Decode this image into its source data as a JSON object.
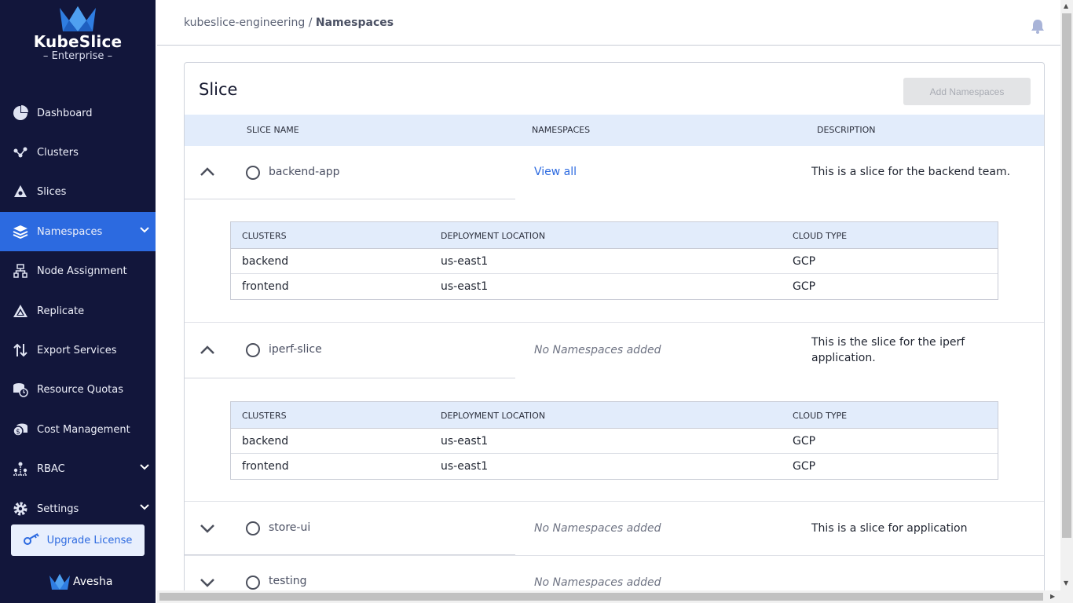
{
  "brand": {
    "title": "KubeSlice",
    "subtitle": "Enterprise",
    "footer": "Avesha"
  },
  "colors": {
    "sidebar_bg": "#12163b",
    "accent": "#2c6ae0",
    "table_header_bg": "#e2ecfb"
  },
  "sidebar": {
    "items": [
      {
        "label": "Dashboard",
        "icon": "pie-chart-icon"
      },
      {
        "label": "Clusters",
        "icon": "cluster-nodes-icon"
      },
      {
        "label": "Slices",
        "icon": "slice-icon"
      },
      {
        "label": "Namespaces",
        "icon": "layers-icon",
        "active": true,
        "expandable": true
      },
      {
        "label": "Node Assignment",
        "icon": "node-tree-icon"
      },
      {
        "label": "Replicate",
        "icon": "replicate-icon"
      },
      {
        "label": "Export Services",
        "icon": "export-arrows-icon"
      },
      {
        "label": "Resource Quotas",
        "icon": "quota-icon"
      },
      {
        "label": "Cost Management",
        "icon": "cost-icon"
      },
      {
        "label": "RBAC",
        "icon": "rbac-icon",
        "expandable": true
      },
      {
        "label": "Settings",
        "icon": "gear-icon",
        "expandable": true
      }
    ],
    "upgrade_label": "Upgrade License"
  },
  "header": {
    "breadcrumb_root": "kubeslice-engineering",
    "breadcrumb_sep": "/",
    "breadcrumb_current": "Namespaces"
  },
  "card": {
    "title": "Slice",
    "add_button": "Add Namespaces",
    "columns": {
      "slice_name": "SLICE NAME",
      "namespaces": "NAMESPACES",
      "description": "DESCRIPTION"
    },
    "sub_columns": {
      "clusters": "CLUSTERS",
      "location": "DEPLOYMENT LOCATION",
      "cloud": "CLOUD TYPE"
    },
    "slices": [
      {
        "name": "backend-app",
        "namespaces": "View all",
        "description": "This is a slice for the backend team.",
        "expanded": true,
        "clusters": [
          {
            "cluster": "backend",
            "location": "us-east1",
            "cloud": "GCP"
          },
          {
            "cluster": "frontend",
            "location": "us-east1",
            "cloud": "GCP"
          }
        ]
      },
      {
        "name": "iperf-slice",
        "namespaces": "No Namespaces added",
        "description": "This is the slice for the iperf application.",
        "expanded": true,
        "clusters": [
          {
            "cluster": "backend",
            "location": "us-east1",
            "cloud": "GCP"
          },
          {
            "cluster": "frontend",
            "location": "us-east1",
            "cloud": "GCP"
          }
        ]
      },
      {
        "name": "store-ui",
        "namespaces": "No Namespaces added",
        "description": "This is a slice for application",
        "expanded": false
      },
      {
        "name": "testing",
        "namespaces": "No Namespaces added",
        "description": "",
        "expanded": false
      }
    ]
  }
}
